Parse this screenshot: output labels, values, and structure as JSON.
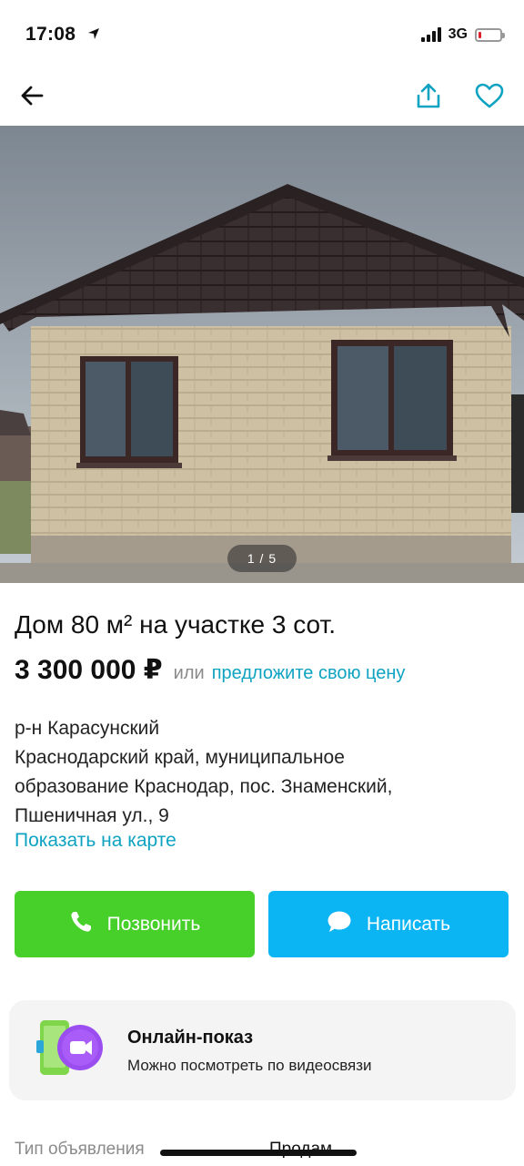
{
  "status_bar": {
    "time": "17:08",
    "network": "3G",
    "battery_level": 0.12,
    "battery_color": "#e0202a"
  },
  "nav": {
    "back_icon": "arrow-left-icon",
    "share_icon": "share-icon",
    "favorite_icon": "heart-icon",
    "accent_color": "#0fa3c2"
  },
  "gallery": {
    "counter": "1 / 5"
  },
  "listing": {
    "title": "Дом 80 м² на участке 3 сот.",
    "price": "3 300 000 ₽",
    "price_or": "или",
    "price_offer_link": "предложите свою цену",
    "address_lines": [
      "р-н Карасунский",
      "Краснодарский край, муниципальное",
      "образование Краснодар, пос. Знаменский,",
      "Пшеничная ул., 9"
    ],
    "map_link": "Показать на карте"
  },
  "actions": {
    "call_label": "Позвонить",
    "call_icon": "phone-icon",
    "call_color": "#47cf2a",
    "write_label": "Написать",
    "write_icon": "chat-bubble-icon",
    "write_color": "#0bb4f3"
  },
  "online_show": {
    "title": "Онлайн-показ",
    "subtitle": "Можно посмотреть по видеосвязи",
    "icon": "video-call-icon"
  },
  "params": [
    {
      "label": "Тип объявления",
      "value": "Продам"
    }
  ]
}
